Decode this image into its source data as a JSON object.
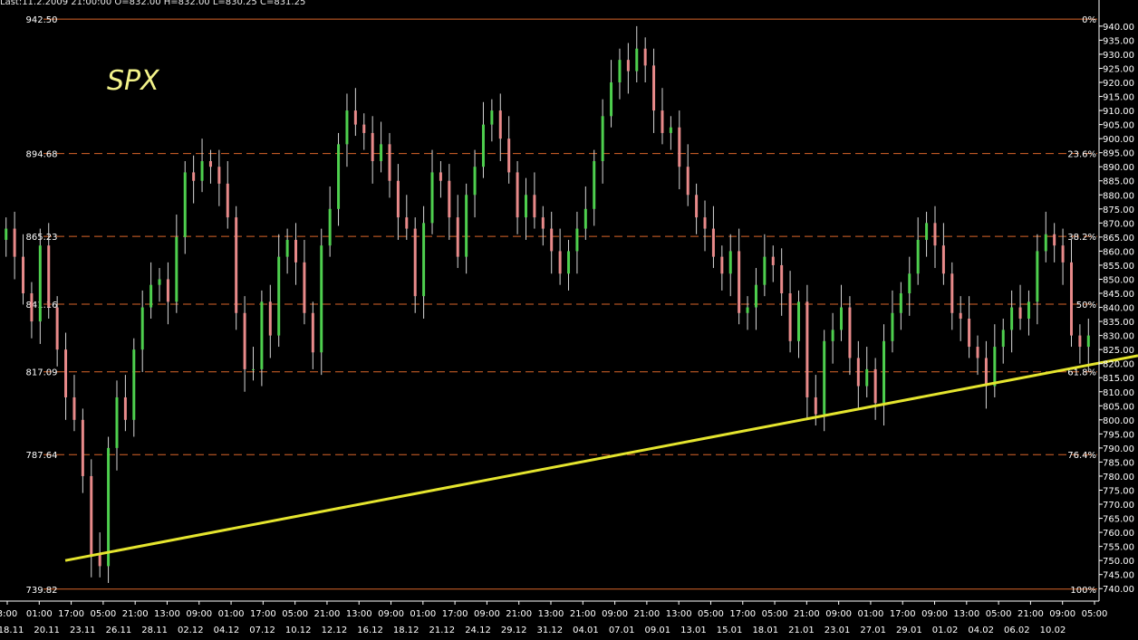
{
  "header": {
    "last_info": "Last:11.2.2009 21:00:00 O=832.00 H=832.00 L=830.25 C=831.25"
  },
  "colors": {
    "background": "#000000",
    "axis": "#ffffff",
    "fib_line": "#d9652a",
    "up_candle": "#4ecf4e",
    "down_candle": "#e88a8a",
    "wick": "#d8d8d8",
    "trendline": "#e5e52e",
    "symbol": "#f2f28a"
  },
  "chart_data": {
    "type": "candlestick",
    "title": "SPX",
    "ylim": [
      737.5,
      943.5
    ],
    "y_ticks": [
      740,
      745,
      750,
      755,
      760,
      765,
      770,
      775,
      780,
      785,
      790,
      795,
      800,
      805,
      810,
      815,
      820,
      825,
      830,
      835,
      840,
      845,
      850,
      855,
      860,
      865,
      870,
      875,
      880,
      885,
      890,
      895,
      900,
      905,
      910,
      915,
      920,
      925,
      930,
      935,
      940
    ],
    "x_time_labels": [
      "3:00",
      "01:00",
      "17:00",
      "05:00",
      "21:00",
      "13:00",
      "09:00",
      "01:00",
      "17:00",
      "05:00",
      "21:00",
      "13:00",
      "09:00",
      "01:00",
      "17:00",
      "09:00",
      "21:00",
      "13:00",
      "21:00",
      "09:00",
      "21:00",
      "13:00",
      "05:00",
      "17:00",
      "05:00",
      "21:00",
      "09:00",
      "01:00",
      "17:00",
      "09:00",
      "13:00",
      "05:00",
      "21:00",
      "09:00",
      "05:00"
    ],
    "x_date_labels": [
      "18.11",
      "20.11",
      "23.11",
      "26.11",
      "28.11",
      "02.12",
      "04.12",
      "07.12",
      "10.12",
      "12.12",
      "16.12",
      "18.12",
      "21.12",
      "24.12",
      "29.12",
      "31.12",
      "04.01",
      "07.01",
      "09.01",
      "13.01",
      "15.01",
      "18.01",
      "21.01",
      "23.01",
      "27.01",
      "29.01",
      "01.02",
      "04.02",
      "06.02",
      "10.02"
    ],
    "fibonacci": [
      {
        "price": 942.5,
        "level": "0%"
      },
      {
        "price": 894.68,
        "level": "23.6%"
      },
      {
        "price": 865.23,
        "level": "38.2%"
      },
      {
        "price": 841.16,
        "level": "50%"
      },
      {
        "price": 817.09,
        "level": "61.8%"
      },
      {
        "price": 787.64,
        "level": "76.4%"
      },
      {
        "price": 739.82,
        "level": "100%"
      }
    ],
    "trendline": {
      "from": {
        "bar_frac": 0.058,
        "price": 750
      },
      "to": {
        "bar_frac": 1.0,
        "price": 820
      }
    },
    "closes": [
      868,
      858,
      845,
      835,
      862,
      840,
      825,
      808,
      800,
      780,
      752,
      748,
      790,
      808,
      800,
      825,
      840,
      848,
      850,
      842,
      865,
      888,
      885,
      892,
      890,
      884,
      872,
      838,
      818,
      818,
      842,
      830,
      858,
      864,
      856,
      838,
      824,
      862,
      875,
      898,
      910,
      905,
      902,
      892,
      898,
      885,
      872,
      868,
      844,
      870,
      888,
      885,
      872,
      858,
      880,
      890,
      905,
      910,
      900,
      888,
      872,
      880,
      872,
      868,
      860,
      852,
      860,
      868,
      875,
      892,
      908,
      920,
      928,
      924,
      932,
      926,
      910,
      902,
      904,
      890,
      880,
      872,
      868,
      858,
      852,
      860,
      838,
      840,
      848,
      858,
      855,
      845,
      828,
      842,
      808,
      802,
      828,
      832,
      840,
      822,
      812,
      818,
      806,
      828,
      838,
      845,
      852,
      864,
      870,
      862,
      852,
      838,
      836,
      826,
      822,
      812,
      826,
      832,
      840,
      836,
      842,
      860,
      866,
      862,
      856,
      830,
      826,
      830
    ]
  }
}
